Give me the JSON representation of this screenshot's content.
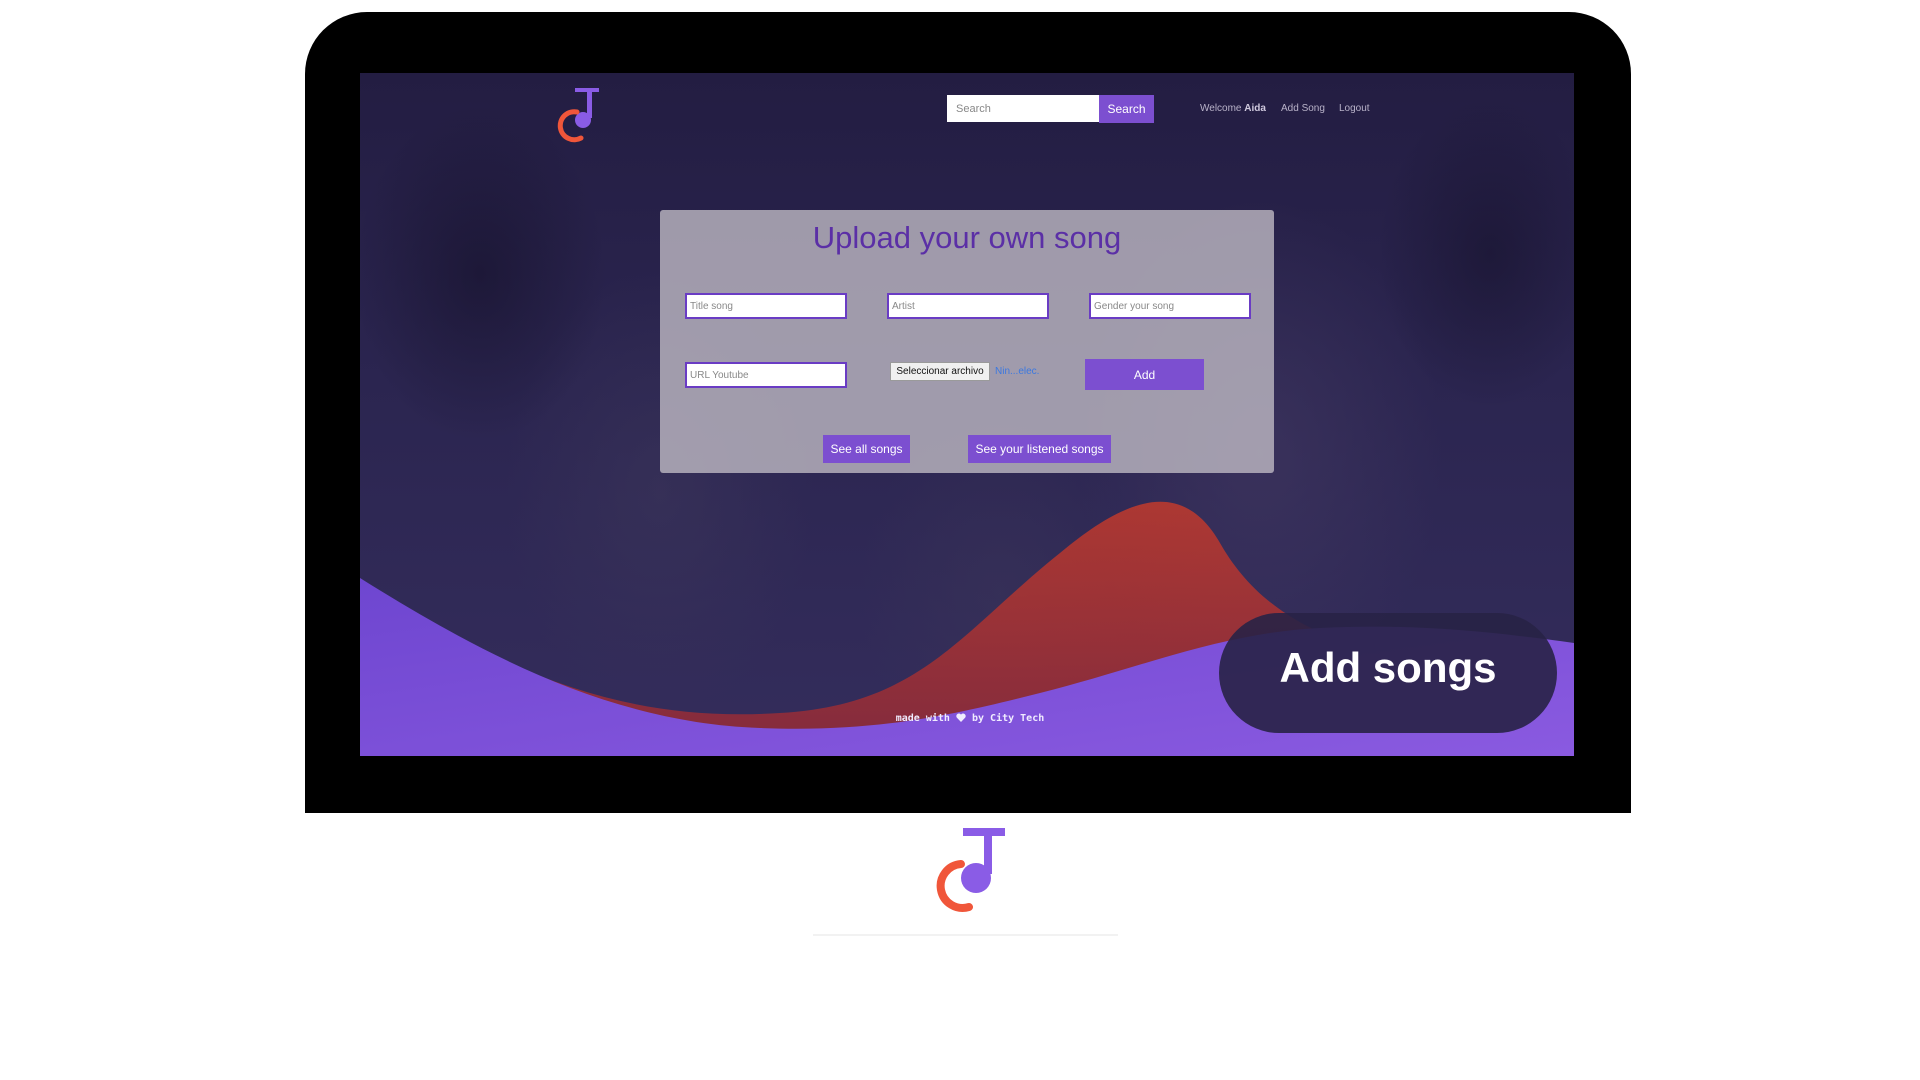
{
  "navbar": {
    "search_placeholder": "Search",
    "search_button": "Search",
    "welcome_prefix": "Welcome ",
    "username": "Aida",
    "add_song_link": "Add Song",
    "logout_link": "Logout"
  },
  "upload_form": {
    "title": "Upload your own song",
    "title_placeholder": "Title song",
    "artist_placeholder": "Artist",
    "genre_placeholder": "Gender your song",
    "url_placeholder": "URL Youtube",
    "file_button": "Seleccionar archivo",
    "file_status": "Nin...elec.",
    "add_button": "Add",
    "see_all_button": "See all songs",
    "see_listened_button": "See your listened songs"
  },
  "footer": {
    "made_with": "made with",
    "by": "by City Tech"
  },
  "badge": {
    "text": "Add songs"
  },
  "colors": {
    "accent_purple": "#7c4fd0",
    "logo_orange": "#f0563a",
    "logo_purple": "#8a5ce6",
    "wave_red": "#b0342a",
    "wave_purple": "#7a52d8",
    "page_background": "#ffffff",
    "monitor_frame": "#000000"
  },
  "icons": {
    "logo": "music-note-logo-icon",
    "heart": "heart-icon"
  }
}
